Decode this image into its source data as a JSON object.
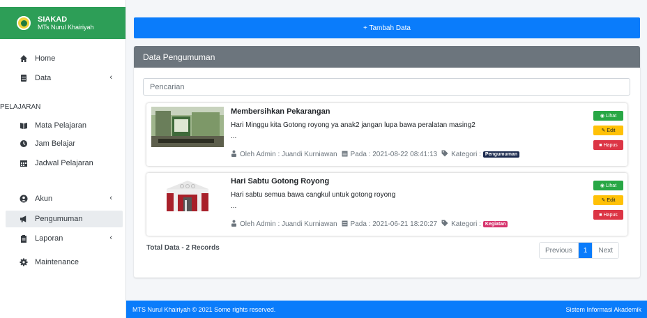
{
  "brand": {
    "title": "SIAKAD",
    "subtitle": "MTs Nurul Khairiyah"
  },
  "sidebar": {
    "items": [
      {
        "label": "Home",
        "icon": "home-icon"
      },
      {
        "label": "Data",
        "icon": "database-icon",
        "caret": "‹"
      }
    ],
    "section_header": "PELAJARAN",
    "pelajaran_items": [
      {
        "label": "Mata Pelajaran",
        "icon": "book-icon"
      },
      {
        "label": "Jam Belajar",
        "icon": "clock-icon"
      },
      {
        "label": "Jadwal Pelajaran",
        "icon": "calendar-icon"
      }
    ],
    "bottom_items": [
      {
        "label": "Akun",
        "icon": "user-circle-icon",
        "caret": "‹"
      },
      {
        "label": "Pengumuman",
        "icon": "bullhorn-icon"
      },
      {
        "label": "Laporan",
        "icon": "clipboard-icon",
        "caret": "‹"
      },
      {
        "label": "Maintenance",
        "icon": "gear-icon"
      }
    ]
  },
  "toolbar": {
    "add_label": "+ Tambah Data"
  },
  "card": {
    "title": "Data Pengumuman"
  },
  "search": {
    "placeholder": "Pencarian"
  },
  "posts": [
    {
      "title": "Membersihkan Pekarangan",
      "body": "Hari Minggu kita Gotong royong ya anak2 jangan lupa bawa peralatan masing2",
      "ellipsis": "...",
      "author": "Oleh Admin : Juandi Kurniawan",
      "date": "Pada : 2021-08-22 08:41:13",
      "category_label": "Kategori :",
      "category": "Pengumuman",
      "category_color": "#1b2a4e"
    },
    {
      "title": "Hari Sabtu Gotong Royong",
      "body": "Hari sabtu semua bawa cangkul untuk gotong royong",
      "ellipsis": "...",
      "author": "Oleh Admin : Juandi Kurniawan",
      "date": "Pada : 2021-06-21 18:20:27",
      "category_label": "Kategori :",
      "category": "Kegiatan",
      "category_color": "#d6336c"
    }
  ],
  "actions": {
    "view": "Lihat",
    "edit": "Edit",
    "delete": "Hapus"
  },
  "list_footer": {
    "total": "Total Data - 2 Records"
  },
  "pagination": {
    "previous": "Previous",
    "current": "1",
    "next": "Next"
  },
  "footer": {
    "left": "MTS Nurul Khairiyah © 2021 Some rights reserved.",
    "right": "Sistem Informasi Akademik"
  },
  "colors": {
    "primary": "#0a7cfb",
    "header_gray": "#6c757d",
    "success": "#28a745",
    "warning": "#ffc107",
    "danger": "#dc3545"
  }
}
